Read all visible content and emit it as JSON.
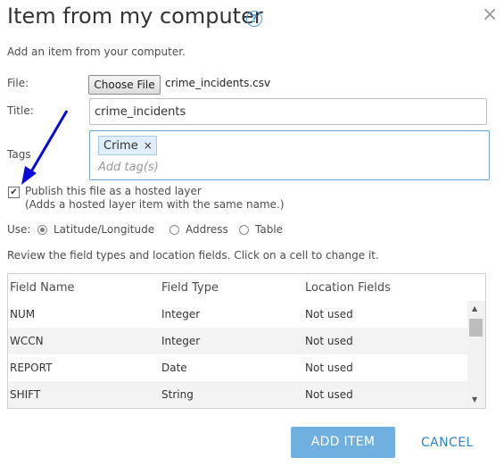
{
  "dialog": {
    "title": "Item from my computer",
    "help_symbol": "?",
    "close_symbol": "×",
    "subtitle": "Add an item from your computer."
  },
  "file": {
    "label": "File:",
    "button_label": "Choose File",
    "filename": "crime_incidents.csv"
  },
  "title_field": {
    "label": "Title:",
    "value": "crime_incidents"
  },
  "tags": {
    "label": "Tags",
    "items": [
      {
        "label": "Crime",
        "remove_symbol": "×"
      }
    ],
    "placeholder": "Add tag(s)"
  },
  "publish": {
    "checked": true,
    "check_symbol": "✔",
    "line1": "Publish this file as a hosted layer",
    "line2": "(Adds a hosted layer item with the same name.)"
  },
  "use": {
    "label": "Use:",
    "options": [
      {
        "label": "Latitude/Longitude",
        "selected": true
      },
      {
        "label": "Address",
        "selected": false
      },
      {
        "label": "Table",
        "selected": false
      }
    ]
  },
  "review_text": "Review the field types and location fields. Click on a cell to change it.",
  "table": {
    "columns": [
      "Field Name",
      "Field Type",
      "Location Fields"
    ],
    "rows": [
      [
        "NUM",
        "Integer",
        "Not used"
      ],
      [
        "WCCN",
        "Integer",
        "Not used"
      ],
      [
        "REPORT",
        "Date",
        "Not used"
      ],
      [
        "SHIFT",
        "String",
        "Not used"
      ]
    ]
  },
  "scrollbar": {
    "up_symbol": "▲",
    "down_symbol": "▼"
  },
  "footer": {
    "add_label": "ADD ITEM",
    "cancel_label": "CANCEL"
  },
  "colors": {
    "primary_button": "#6fb0e0",
    "link": "#2f83c9",
    "annotation_arrow": "#0a0ad6"
  }
}
